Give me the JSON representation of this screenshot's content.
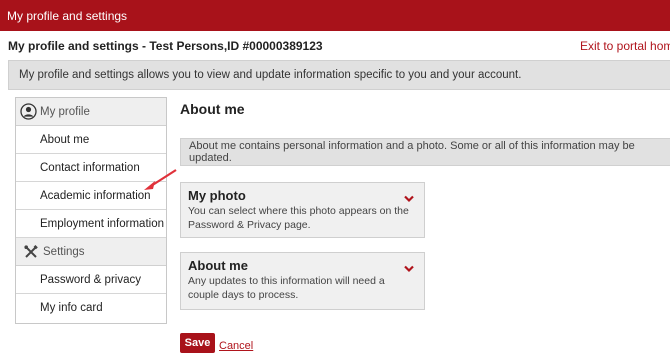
{
  "app": {
    "title": "My profile and settings"
  },
  "subheader": {
    "title": "My profile and settings - Test Persons,ID #00000389123",
    "exit_link": "Exit to portal hom"
  },
  "info": {
    "text": "My profile and settings allows you to view and update information specific to you and your account."
  },
  "sidebar": {
    "profile_header": "My profile",
    "profile_items": [
      {
        "label": "About me"
      },
      {
        "label": "Contact information"
      },
      {
        "label": "Academic information"
      },
      {
        "label": "Employment information"
      }
    ],
    "settings_header": "Settings",
    "settings_items": [
      {
        "label": "Password & privacy"
      },
      {
        "label": "My info card"
      }
    ]
  },
  "main": {
    "title": "About me",
    "banner": "About me contains personal information and a photo. Some or all of this information may be updated.",
    "cards": [
      {
        "title": "My photo",
        "desc": "You can select where this photo appears on the Password & Privacy page."
      },
      {
        "title": "About me",
        "desc": "Any updates to this information will need a couple days to process."
      }
    ],
    "save_label": "Save",
    "cancel_label": "Cancel"
  },
  "colors": {
    "brand": "#a8121a",
    "link": "#b0141c",
    "panel": "#e1e1e1",
    "annotation_arrow": "#e0313a"
  },
  "icons": {
    "profile": "person-circle-icon",
    "settings": "tools-icon",
    "expand": "chevron-down-icon"
  }
}
